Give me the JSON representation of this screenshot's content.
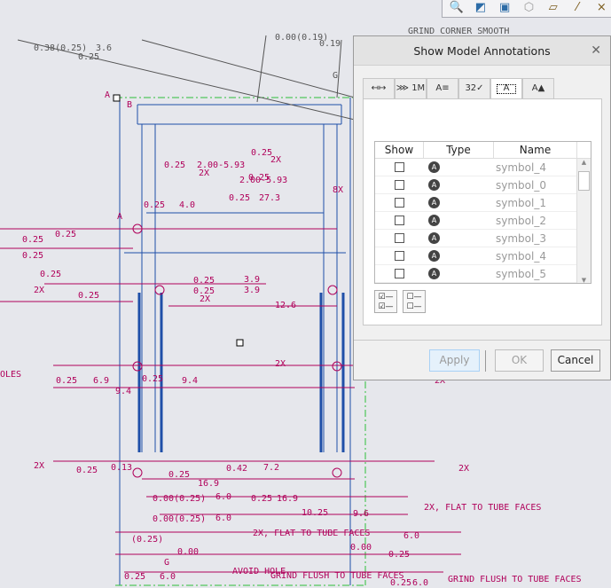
{
  "toolbar": {
    "icons": [
      "zoom-window-icon",
      "shading-icon",
      "view-cube-icon",
      "saved-views-icon",
      "plane-display-icon",
      "axis-display-icon",
      "point-display-icon"
    ]
  },
  "drawing": {
    "labels": [
      "0.38(0.25)",
      "3.6",
      "0.25",
      "0.00(0.19)",
      "0.19",
      "GRIND CORNER SMOOTH",
      "G",
      "A",
      "B",
      "0.25",
      "2.00-5.93",
      "2X",
      "2X",
      "0.25",
      "2.00-5.93",
      "0.25",
      "27.3",
      "0.25",
      "4.0",
      "8X",
      "A",
      "0.25",
      "0.25",
      "0.25",
      "0.25",
      "0.25",
      "2X",
      "0.25",
      "0.25",
      "3.9",
      "0.25",
      "3.9",
      "2X",
      "12.6",
      "OLES",
      "0.25",
      "6.9",
      "9.4",
      "0.25",
      "9.4",
      "2X",
      "2X",
      "2X",
      "0.25",
      "0.13",
      "0.42",
      "7.2",
      "0.25",
      "16.9",
      "2X",
      "0.00(0.25)",
      "6.0",
      "0.25",
      "16.9",
      "0.00(0.25)",
      "6.0",
      "10.25",
      "9.6",
      "2X, FLAT TO TUBE FACES",
      "(0.25)",
      "0.00",
      "2X, FLAT TO TUBE FACES",
      "6.0",
      "0.00",
      "0.25",
      "G",
      "AVOID HOLE",
      "GRIND FLUSH TO TUBE FACES",
      "GRIND FLUSH TO TUBE FACES",
      "0.25",
      "6.0",
      "0.25",
      "6.0"
    ],
    "colors": {
      "annotation": "#b0005a",
      "geometry": "#1f4fa8",
      "centerline": "#2fbf3a",
      "leader": "#555555"
    }
  },
  "dialog": {
    "title": "Show Model Annotations",
    "close_label": "✕",
    "tabs": [
      {
        "label": "↤↦",
        "name": "dimensions"
      },
      {
        "label": "⋙ 1M",
        "name": "gtol"
      },
      {
        "label": "A≡",
        "name": "notes"
      },
      {
        "label": "32✓",
        "name": "surface-finish"
      },
      {
        "label": "A",
        "name": "symbols",
        "active": true
      },
      {
        "label": "A▲",
        "name": "datums"
      }
    ],
    "table": {
      "headers": {
        "show": "Show",
        "type": "Type",
        "name": "Name"
      },
      "rows": [
        {
          "name": "symbol_4",
          "checked": false
        },
        {
          "name": "symbol_0",
          "checked": false
        },
        {
          "name": "symbol_1",
          "checked": false
        },
        {
          "name": "symbol_2",
          "checked": false
        },
        {
          "name": "symbol_3",
          "checked": false
        },
        {
          "name": "symbol_4",
          "checked": false
        },
        {
          "name": "symbol_5",
          "checked": false
        }
      ]
    },
    "select_all_label": "☑—\n☑—",
    "deselect_all_label": "☐—\n☐—",
    "buttons": {
      "apply": "Apply",
      "ok": "OK",
      "cancel": "Cancel"
    }
  }
}
